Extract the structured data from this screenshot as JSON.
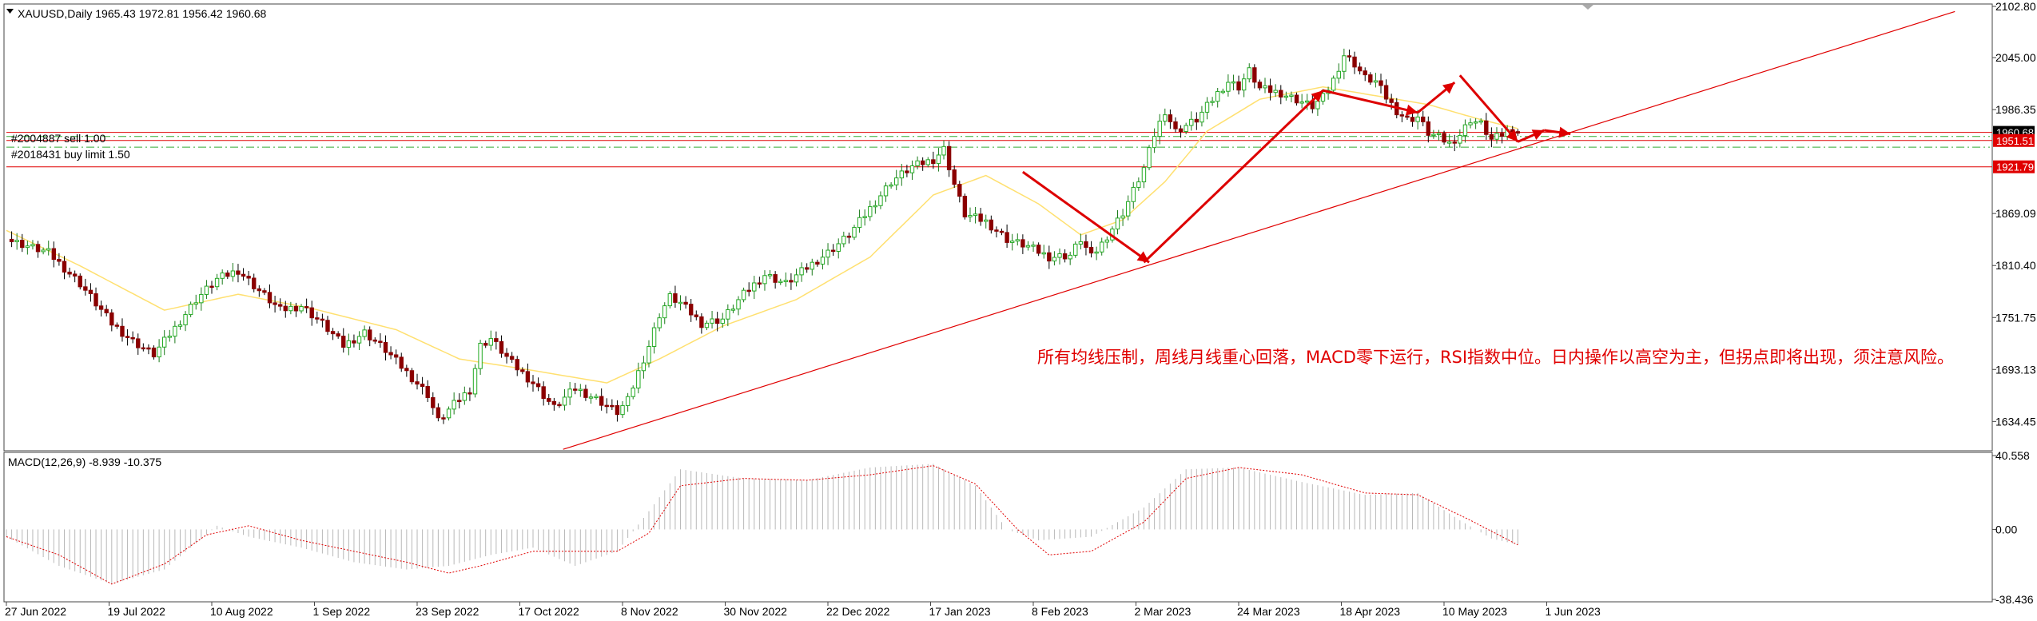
{
  "window": {
    "symbol_header": "XAUUSD,Daily  1965.43 1972.81 1956.42 1960.68",
    "collapse_icon": "triangle-down-icon"
  },
  "orders": [
    {
      "label": "#2004887 sell 1.00",
      "price": 1960.68,
      "tag": "1960.68",
      "line": "solid-red"
    },
    {
      "label": "#2018431 buy limit 1.50",
      "price": 1951.51,
      "tag": "1951.51",
      "line": "solid-red"
    },
    {
      "label": "",
      "price": 1921.79,
      "tag": "1921.79",
      "line": "solid-red"
    }
  ],
  "annotation_text": "所有均线压制，周线月线重心回落，MACD零下运行，RSI指数中位。日内操作以高空为主，但拐点即将出现，须注意风险。",
  "macd_label": "MACD(12,26,9) -8.939 -10.375",
  "colors": {
    "up": "#22aa22",
    "down": "#8b0000",
    "ma": "#ffe070",
    "signal": "#e00000",
    "hist": "#b8b8b8",
    "trend": "#e00000",
    "support_dash": "#33aa33"
  },
  "chart_data": [
    {
      "type": "candlestick",
      "title": "XAUUSD,Daily  1965.43 1972.81 1956.42 1960.68",
      "ylim": [
        1605,
        2102.8
      ],
      "y_ticks": [
        "2102.80",
        "2045.00",
        "1986.35",
        "1869.09",
        "1810.40",
        "1751.75",
        "1693.13",
        "1634.45"
      ],
      "x_ticks": [
        "27 Jun 2022",
        "19 Jul 2022",
        "10 Aug 2022",
        "1 Sep 2022",
        "23 Sep 2022",
        "17 Oct 2022",
        "8 Nov 2022",
        "30 Nov 2022",
        "22 Dec 2022",
        "17 Jan 2023",
        "8 Feb 2023",
        "2 Mar 2023",
        "24 Mar 2023",
        "18 Apr 2023",
        "10 May 2023",
        "1 Jun 2023"
      ],
      "price_path": [
        [
          0,
          1840
        ],
        [
          8,
          1825
        ],
        [
          14,
          1790
        ],
        [
          20,
          1745
        ],
        [
          24,
          1725
        ],
        [
          28,
          1710
        ],
        [
          32,
          1740
        ],
        [
          36,
          1772
        ],
        [
          40,
          1795
        ],
        [
          44,
          1805
        ],
        [
          48,
          1782
        ],
        [
          52,
          1760
        ],
        [
          56,
          1765
        ],
        [
          60,
          1745
        ],
        [
          64,
          1720
        ],
        [
          68,
          1735
        ],
        [
          72,
          1715
        ],
        [
          76,
          1690
        ],
        [
          80,
          1665
        ],
        [
          82,
          1635
        ],
        [
          86,
          1660
        ],
        [
          88,
          1670
        ],
        [
          90,
          1720
        ],
        [
          92,
          1728
        ],
        [
          96,
          1700
        ],
        [
          100,
          1678
        ],
        [
          104,
          1650
        ],
        [
          108,
          1672
        ],
        [
          112,
          1660
        ],
        [
          116,
          1645
        ],
        [
          118,
          1658
        ],
        [
          120,
          1690
        ],
        [
          122,
          1720
        ],
        [
          124,
          1755
        ],
        [
          126,
          1775
        ],
        [
          128,
          1768
        ],
        [
          132,
          1745
        ],
        [
          136,
          1750
        ],
        [
          140,
          1778
        ],
        [
          144,
          1800
        ],
        [
          148,
          1790
        ],
        [
          152,
          1808
        ],
        [
          156,
          1825
        ],
        [
          160,
          1845
        ],
        [
          164,
          1875
        ],
        [
          168,
          1905
        ],
        [
          172,
          1922
        ],
        [
          176,
          1930
        ],
        [
          178,
          1942
        ],
        [
          180,
          1902
        ],
        [
          182,
          1868
        ],
        [
          186,
          1860
        ],
        [
          190,
          1840
        ],
        [
          194,
          1832
        ],
        [
          198,
          1820
        ],
        [
          202,
          1822
        ],
        [
          204,
          1840
        ],
        [
          206,
          1820
        ],
        [
          208,
          1835
        ],
        [
          212,
          1870
        ],
        [
          216,
          1920
        ],
        [
          218,
          1958
        ],
        [
          220,
          1985
        ],
        [
          222,
          1962
        ],
        [
          226,
          1975
        ],
        [
          228,
          1990
        ],
        [
          230,
          2005
        ],
        [
          232,
          2018
        ],
        [
          234,
          2012
        ],
        [
          236,
          2030
        ],
        [
          238,
          2010
        ],
        [
          242,
          2005
        ],
        [
          244,
          2000
        ],
        [
          246,
          1995
        ],
        [
          248,
          1990
        ],
        [
          250,
          2000
        ],
        [
          252,
          2020
        ],
        [
          254,
          2048
        ],
        [
          256,
          2038
        ],
        [
          258,
          2022
        ],
        [
          260,
          2018
        ],
        [
          262,
          2000
        ],
        [
          264,
          1985
        ],
        [
          266,
          1975
        ],
        [
          268,
          1978
        ],
        [
          270,
          1960
        ],
        [
          272,
          1955
        ],
        [
          274,
          1948
        ],
        [
          276,
          1958
        ],
        [
          278,
          1975
        ],
        [
          280,
          1970
        ],
        [
          282,
          1952
        ],
        [
          284,
          1958
        ],
        [
          286,
          1966
        ],
        [
          287,
          1960.68
        ]
      ],
      "ma_path": [
        [
          0,
          1850
        ],
        [
          14,
          1810
        ],
        [
          30,
          1760
        ],
        [
          44,
          1778
        ],
        [
          58,
          1762
        ],
        [
          74,
          1738
        ],
        [
          86,
          1705
        ],
        [
          100,
          1692
        ],
        [
          114,
          1678
        ],
        [
          124,
          1705
        ],
        [
          136,
          1742
        ],
        [
          150,
          1772
        ],
        [
          164,
          1820
        ],
        [
          176,
          1890
        ],
        [
          186,
          1912
        ],
        [
          196,
          1880
        ],
        [
          204,
          1845
        ],
        [
          212,
          1862
        ],
        [
          220,
          1905
        ],
        [
          228,
          1962
        ],
        [
          238,
          1998
        ],
        [
          250,
          2012
        ],
        [
          260,
          2002
        ],
        [
          270,
          1992
        ],
        [
          280,
          1975
        ],
        [
          287,
          1965
        ]
      ],
      "trendline": [
        [
          0.28,
          1603
        ],
        [
          0.98,
          2097
        ]
      ],
      "support_levels": [
        1956,
        1944
      ],
      "arrows": [
        {
          "from": [
            193,
            1916
          ],
          "to": [
            217,
            1814
          ]
        },
        {
          "from": [
            216,
            1814
          ],
          "to": [
            250,
            2008
          ]
        },
        {
          "from": [
            250,
            2008
          ],
          "to": [
            268,
            1983
          ]
        },
        {
          "from": [
            268,
            1983
          ],
          "to": [
            275,
            2017
          ]
        },
        {
          "from": [
            276,
            2025
          ],
          "to": [
            287,
            1950
          ]
        },
        {
          "from": [
            287,
            1950
          ],
          "to": [
            292,
            1963
          ]
        },
        {
          "from": [
            292,
            1963
          ],
          "to": [
            297,
            1959
          ]
        }
      ]
    },
    {
      "type": "bar",
      "title": "MACD(12,26,9) -8.939 -10.375",
      "ylim": [
        -38.436,
        40.558
      ],
      "y_ticks": [
        "40.558",
        "0.00",
        "-38.436"
      ],
      "histogram_path": [
        [
          0,
          -4
        ],
        [
          10,
          -20
        ],
        [
          20,
          -30
        ],
        [
          30,
          -22
        ],
        [
          40,
          2
        ],
        [
          46,
          -4
        ],
        [
          56,
          -10
        ],
        [
          66,
          -18
        ],
        [
          76,
          -22
        ],
        [
          84,
          -20
        ],
        [
          92,
          -14
        ],
        [
          100,
          -10
        ],
        [
          108,
          -20
        ],
        [
          116,
          -12
        ],
        [
          122,
          10
        ],
        [
          128,
          33
        ],
        [
          140,
          28
        ],
        [
          152,
          27
        ],
        [
          164,
          34
        ],
        [
          176,
          36
        ],
        [
          184,
          24
        ],
        [
          190,
          0
        ],
        [
          196,
          -6
        ],
        [
          206,
          -4
        ],
        [
          216,
          12
        ],
        [
          224,
          33
        ],
        [
          234,
          34
        ],
        [
          246,
          26
        ],
        [
          258,
          19
        ],
        [
          268,
          20
        ],
        [
          276,
          5
        ],
        [
          282,
          -5
        ],
        [
          288,
          -9
        ]
      ],
      "signal_path": [
        [
          0,
          -4
        ],
        [
          10,
          -14
        ],
        [
          20,
          -30
        ],
        [
          30,
          -19
        ],
        [
          38,
          -3
        ],
        [
          46,
          2
        ],
        [
          56,
          -6
        ],
        [
          66,
          -12
        ],
        [
          76,
          -18
        ],
        [
          84,
          -24
        ],
        [
          90,
          -20
        ],
        [
          100,
          -12
        ],
        [
          110,
          -12
        ],
        [
          116,
          -12
        ],
        [
          122,
          -2
        ],
        [
          128,
          24
        ],
        [
          140,
          28
        ],
        [
          152,
          27
        ],
        [
          164,
          30
        ],
        [
          176,
          35
        ],
        [
          184,
          25
        ],
        [
          192,
          0
        ],
        [
          198,
          -14
        ],
        [
          206,
          -12
        ],
        [
          216,
          4
        ],
        [
          224,
          28
        ],
        [
          234,
          34
        ],
        [
          246,
          30
        ],
        [
          258,
          20
        ],
        [
          268,
          19
        ],
        [
          278,
          5
        ],
        [
          288,
          -10
        ]
      ]
    }
  ]
}
